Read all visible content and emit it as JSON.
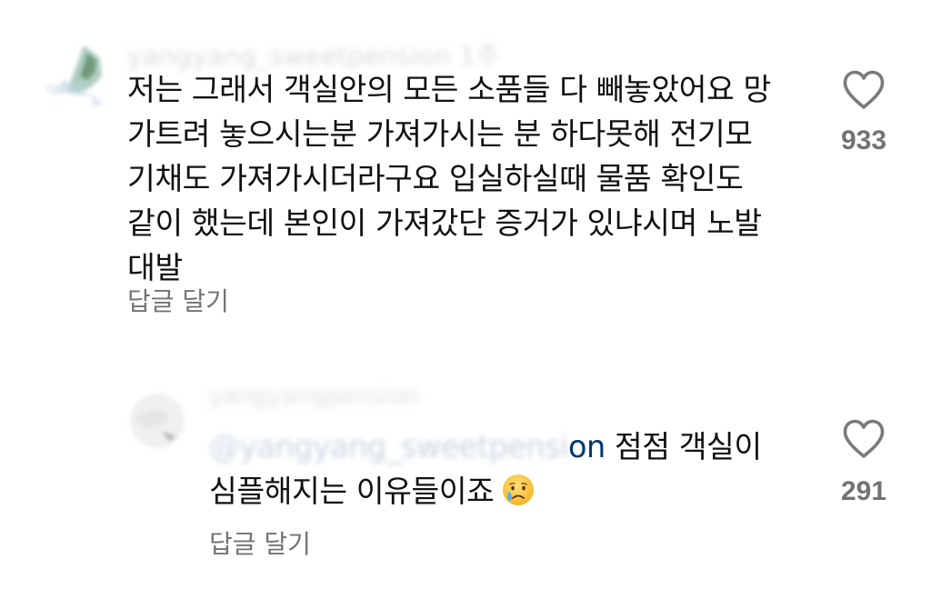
{
  "comments": [
    {
      "username": "yangyang_sweetpension 1주",
      "lines": [
        "저는 그래서 객실안의 모든 소품들 다 빼놓았어요 망",
        "가트려 놓으시는분 가져가시는 분 하다못해 전기모",
        "기채도 가져가시더라구요 입실하실때 물품 확인도",
        "같이 했는데 본인이 가져갔단 증거가 있냐시며 노발",
        "대발"
      ],
      "reply_label": "답글 달기",
      "like_count": "933",
      "like_icon": "heart-outline-icon"
    },
    {
      "username": "yangyangpension",
      "mention_blurred": "@yangyang_sweetpensi",
      "mention_visible": "on",
      "text_line1": " 점점 객실이",
      "text_line2": "심플해지는 이유들이죠",
      "emoji": "crying-face-emoji",
      "reply_label": "답글 달기",
      "like_count": "291",
      "like_icon": "heart-outline-icon"
    }
  ],
  "colors": {
    "text": "#111111",
    "secondary": "#737373",
    "mention": "#00376b",
    "background": "#ffffff"
  }
}
